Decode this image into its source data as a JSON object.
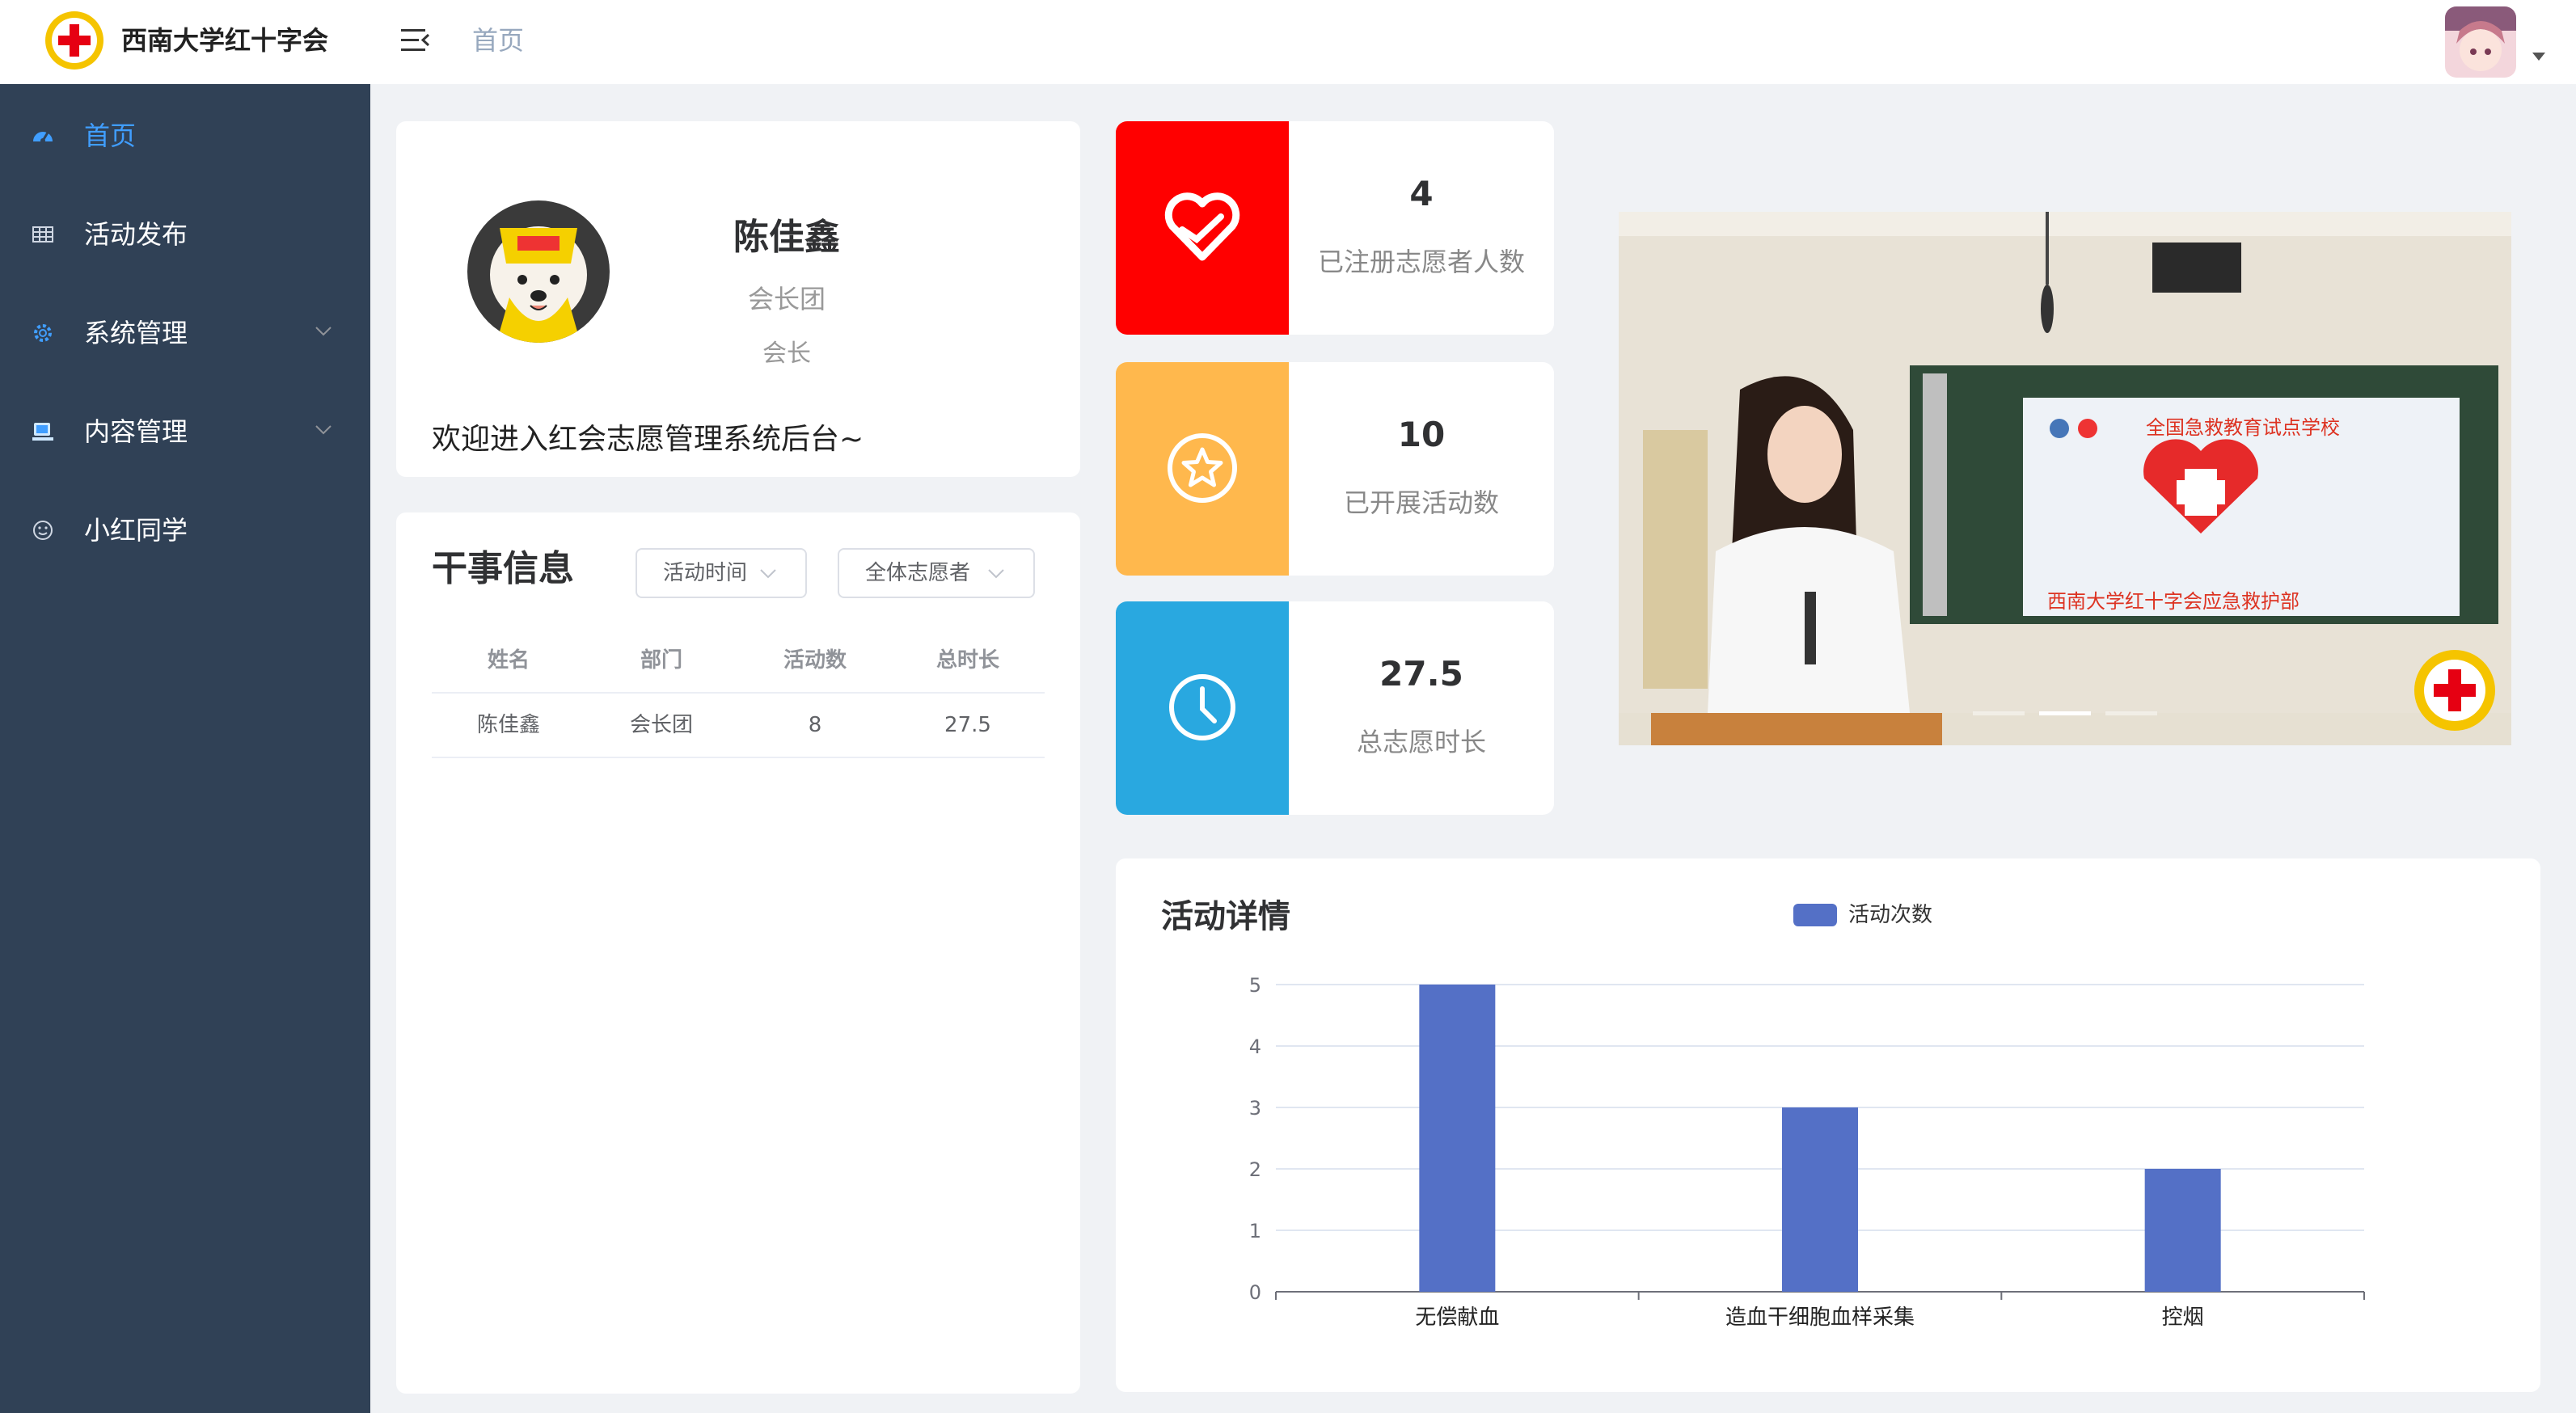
{
  "app": {
    "title": "西南大学红十字会"
  },
  "header": {
    "breadcrumb": "首页"
  },
  "sidebar": {
    "items": [
      {
        "label": "首页",
        "icon": "dashboard-icon",
        "active": true
      },
      {
        "label": "活动发布",
        "icon": "table-icon"
      },
      {
        "label": "系统管理",
        "icon": "gear-icon",
        "expandable": true
      },
      {
        "label": "内容管理",
        "icon": "monitor-icon",
        "expandable": true
      },
      {
        "label": "小红同学",
        "icon": "smiley-icon"
      }
    ]
  },
  "profile": {
    "name": "陈佳鑫",
    "department": "会长团",
    "role": "会长",
    "welcome": "欢迎进入红会志愿管理系统后台~"
  },
  "staff": {
    "title": "干事信息",
    "filter_time": "活动时间",
    "filter_scope": "全体志愿者",
    "columns": [
      "姓名",
      "部门",
      "活动数",
      "总时长"
    ],
    "rows": [
      [
        "陈佳鑫",
        "会长团",
        "8",
        "27.5"
      ]
    ]
  },
  "stats": [
    {
      "value": "4",
      "label": "已注册志愿者人数",
      "color": "#ff0000",
      "icon": "heart-hand-icon"
    },
    {
      "value": "10",
      "label": "已开展活动数",
      "color": "#ffb84d",
      "icon": "star-circle-icon"
    },
    {
      "value": "27.5",
      "label": "总志愿时长",
      "color": "#29a8e0",
      "icon": "clock-icon"
    }
  ],
  "carousel": {
    "banner_top": "全国急救教育试点学校",
    "banner_bottom": "西南大学红十字会应急救护部",
    "active_index": 1,
    "slide_count": 3
  },
  "colors": {
    "sidebar_bg": "#304156",
    "accent": "#409eff",
    "chart_bar": "#5470c6"
  },
  "chart_data": {
    "type": "bar",
    "title": "活动详情",
    "legend_position": "top-center",
    "categories": [
      "无偿献血",
      "造血干细胞血样采集",
      "控烟"
    ],
    "series": [
      {
        "name": "活动次数",
        "values": [
          5,
          3,
          2
        ]
      }
    ],
    "ylim": [
      0,
      5
    ],
    "yticks": [
      0,
      1,
      2,
      3,
      4,
      5
    ],
    "grid": true
  }
}
